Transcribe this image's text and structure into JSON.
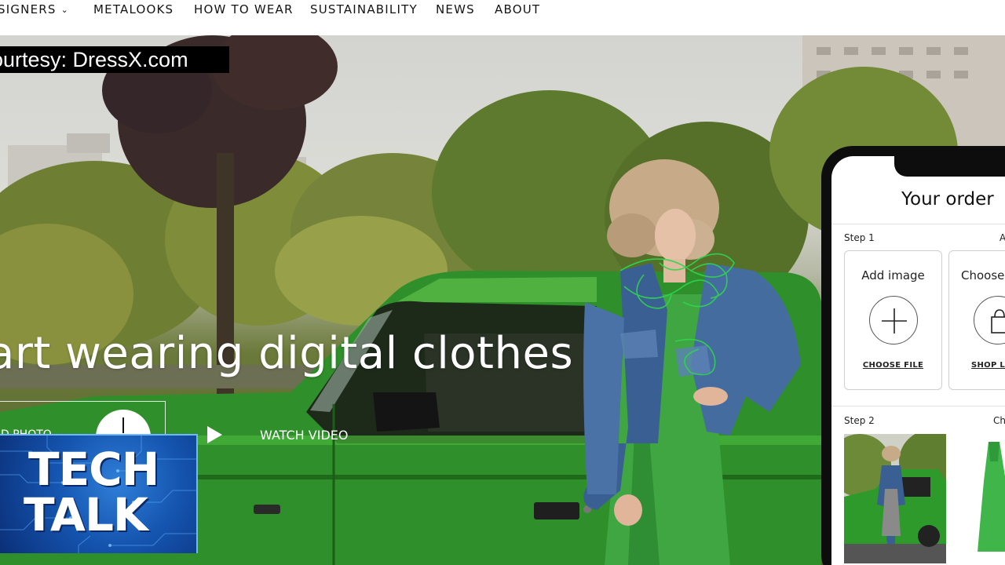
{
  "nav": {
    "items": [
      {
        "label": "SIGNERS",
        "has_dropdown": true
      },
      {
        "label": "METALOOKS"
      },
      {
        "label": "HOW TO WEAR"
      },
      {
        "label": "SUSTAINABILITY"
      },
      {
        "label": "NEWS"
      },
      {
        "label": "ABOUT"
      }
    ]
  },
  "overlay": {
    "courtesy": "ourtesy: DressX.com"
  },
  "hero": {
    "headline": "art wearing digital clothes",
    "upload_label": "D PHOTO",
    "watch_label": "WATCH VIDEO"
  },
  "logo": {
    "line1": "TECH",
    "line2": "TALK"
  },
  "phone": {
    "title": "Your order",
    "step1": "Step 1",
    "step1_right": "A",
    "card1": {
      "title": "Add image",
      "link": "CHOOSE FILE"
    },
    "card2": {
      "title": "Choose",
      "link": "SHOP LO"
    },
    "step2": "Step 2",
    "step2_right": "Ch"
  },
  "colors": {
    "car_green": "#2f8f2a",
    "dress_green": "#3fa642",
    "denim": "#3a5f92",
    "logo_blue": "#1555b0"
  },
  "icons": {
    "dropdown": "chevron-down-icon",
    "upload": "plus-icon",
    "video": "play-icon",
    "add_image": "plus-icon",
    "shop": "shopping-bag-icon"
  }
}
